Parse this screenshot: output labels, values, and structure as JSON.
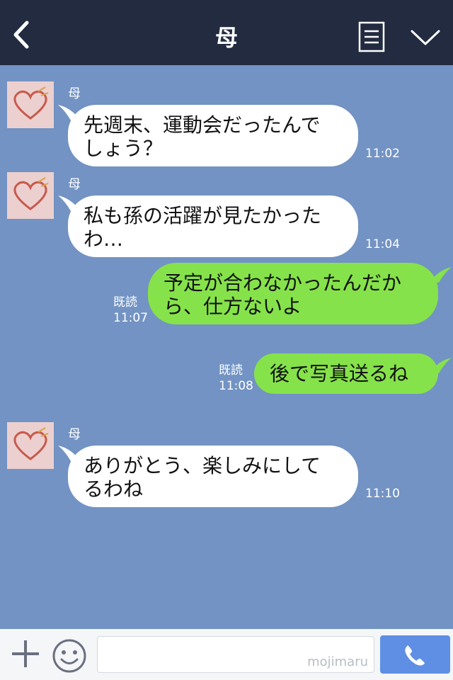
{
  "header": {
    "title": "母",
    "back_icon": "chevron-left-icon",
    "menu_icon": "document-menu-icon",
    "more_icon": "chevron-down-icon"
  },
  "messages": [
    {
      "side": "left",
      "sender": "母",
      "lines": [
        "先週末、運動会だったんで",
        "しょう？"
      ],
      "time": "11:02"
    },
    {
      "side": "left",
      "sender": "母",
      "lines": [
        "私も孫の活躍が見たかった",
        "わ…"
      ],
      "time": "11:04"
    },
    {
      "side": "right",
      "read": "既読",
      "lines": [
        "予定が合わなかったんだか",
        "ら、仕方ないよ"
      ],
      "time": "11:07"
    },
    {
      "side": "right",
      "read": "既読",
      "lines": [
        "後で写真送るね"
      ],
      "time": "11:08"
    },
    {
      "side": "left",
      "sender": "母",
      "lines": [
        "ありがとう、楽しみにして",
        "るわね"
      ],
      "time": "11:10"
    }
  ],
  "footer": {
    "watermark": "mojimaru",
    "plus_icon": "plus-icon",
    "emoji_icon": "smiley-icon",
    "call_icon": "phone-icon"
  },
  "colors": {
    "header_bg": "#222b40",
    "chat_bg": "#7293c3",
    "left_bubble": "#ffffff",
    "right_bubble": "#86e24a",
    "call_button": "#5f8fe5"
  }
}
